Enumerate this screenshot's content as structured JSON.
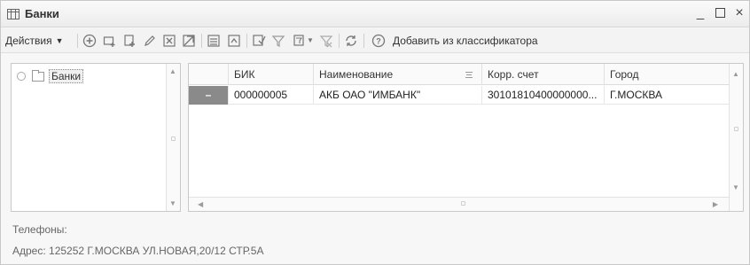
{
  "window": {
    "title": "Банки",
    "minimize": "_",
    "close": "×"
  },
  "toolbar": {
    "actions_label": "Действия",
    "add_from_classifier_label": "Добавить из классификатора",
    "icons": [
      "add-circle-icon",
      "add-group-icon",
      "copy-icon",
      "edit-icon",
      "delete-icon",
      "mark-delete-icon",
      "hierarchy-icon",
      "move-to-group-icon",
      "filter-icon",
      "filter-by-value-icon",
      "filter-dropdown-icon",
      "clear-filter-icon",
      "refresh-icon",
      "help-icon"
    ]
  },
  "tree": {
    "items": [
      {
        "label": "Банки"
      }
    ]
  },
  "grid": {
    "columns": [
      "БИК",
      "Наименование",
      "Корр. счет",
      "Город"
    ],
    "rows": [
      {
        "marker": "–",
        "bik": "000000005",
        "name": "АКБ ОАО \"ИМБАНК\"",
        "corr_account": "30101810400000000...",
        "city": "Г.МОСКВА"
      }
    ]
  },
  "details": {
    "phones": "Телефоны:",
    "address": "Адрес: 125252 Г.МОСКВА УЛ.НОВАЯ,20/12 СТР.5А"
  },
  "colors": {
    "selected_row_marker": "#8a8a8a",
    "window_bg": "#f7f7f7",
    "help_icon": "#e0a020",
    "refresh_icon": "#3a8fd0"
  }
}
